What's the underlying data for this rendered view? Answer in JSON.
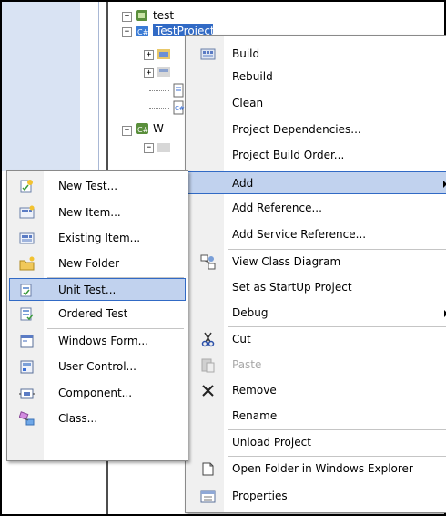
{
  "tree": {
    "nodes": [
      {
        "label": "test"
      },
      {
        "label": "TestProject"
      },
      {
        "label": "W"
      }
    ]
  },
  "context_menu": {
    "items": [
      {
        "label": "Build",
        "icon": "build-icon"
      },
      {
        "label": "Rebuild"
      },
      {
        "label": "Clean"
      },
      {
        "label": "Project Dependencies..."
      },
      {
        "label": "Project Build Order..."
      },
      {
        "label": "Add",
        "submenu": true,
        "highlighted": true
      },
      {
        "label": "Add Reference..."
      },
      {
        "label": "Add Service Reference..."
      },
      {
        "label": "View Class Diagram",
        "icon": "class-diagram-icon"
      },
      {
        "label": "Set as StartUp Project"
      },
      {
        "label": "Debug",
        "submenu": true
      },
      {
        "label": "Cut",
        "icon": "cut-icon"
      },
      {
        "label": "Paste",
        "icon": "paste-icon",
        "disabled": true
      },
      {
        "label": "Remove",
        "icon": "remove-icon"
      },
      {
        "label": "Rename"
      },
      {
        "label": "Unload Project"
      },
      {
        "label": "Open Folder in Windows Explorer",
        "icon": "open-folder-icon"
      },
      {
        "label": "Properties",
        "icon": "properties-icon"
      }
    ]
  },
  "add_submenu": {
    "items": [
      {
        "label": "New Test...",
        "icon": "new-test-icon"
      },
      {
        "label": "New Item...",
        "icon": "new-item-icon"
      },
      {
        "label": "Existing Item...",
        "icon": "existing-item-icon"
      },
      {
        "label": "New Folder",
        "icon": "new-folder-icon"
      },
      {
        "label": "Unit Test...",
        "icon": "unit-test-icon",
        "highlighted": true
      },
      {
        "label": "Ordered Test",
        "icon": "ordered-test-icon"
      },
      {
        "label": "Windows Form...",
        "icon": "windows-form-icon"
      },
      {
        "label": "User Control...",
        "icon": "user-control-icon"
      },
      {
        "label": "Component...",
        "icon": "component-icon"
      },
      {
        "label": "Class...",
        "icon": "class-icon"
      }
    ]
  },
  "colors": {
    "highlight": "#c1d2ee",
    "highlight_border": "#316ac5",
    "selection": "#316ac5"
  }
}
